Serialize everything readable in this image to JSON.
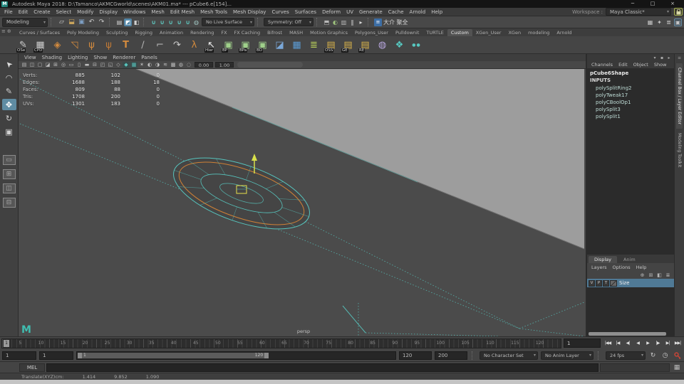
{
  "window": {
    "app_icon": "M",
    "title": "Autodesk Maya 2018: D:\\Tamanco\\AKMCGworld\\scenes\\AKM01.ma* --- pCube6.e[154]...",
    "minimize": "─",
    "maximize": "□",
    "close": "×"
  },
  "menubar": {
    "items": [
      "File",
      "Edit",
      "Create",
      "Select",
      "Modify",
      "Display",
      "Windows",
      "Mesh",
      "Edit Mesh",
      "Mesh Tools",
      "Mesh Display",
      "Curves",
      "Surfaces",
      "Deform",
      "UV",
      "Generate",
      "Cache",
      "Arnold",
      "Help"
    ],
    "workspace_label": "Workspace :",
    "workspace_value": "Maya Classic*"
  },
  "statusline": {
    "mode": "Modeling",
    "file_icons": [
      {
        "name": "new-scene-icon",
        "glyph": "▱",
        "style": "color:#cfcfcf"
      },
      {
        "name": "open-scene-icon",
        "glyph": "⬓",
        "style": "color:#c9a45c"
      },
      {
        "name": "save-scene-icon",
        "glyph": "▣",
        "style": "color:#7e9fc4"
      },
      {
        "name": "undo-icon",
        "glyph": "↶",
        "style": "color:#cccccc"
      },
      {
        "name": "redo-icon",
        "glyph": "↷",
        "style": "color:#cccccc"
      }
    ],
    "mask_icons": [
      {
        "name": "select-hierarchy-icon",
        "glyph": "▤",
        "style": "color:#d0d0d0"
      },
      {
        "name": "select-object-icon",
        "glyph": "◩",
        "style": "color:#ffffff",
        "active": true
      },
      {
        "name": "select-component-icon",
        "glyph": "◧",
        "style": "color:#d0d0d0"
      }
    ],
    "snap_icons": [
      {
        "name": "snap-grid-icon",
        "glyph": "∪",
        "style": "color:#5fc8c0;font-weight:bold"
      },
      {
        "name": "snap-curve-icon",
        "glyph": "∪",
        "style": "color:#5fc8c0;font-weight:bold"
      },
      {
        "name": "snap-point-icon",
        "glyph": "∪",
        "style": "color:#5fc8c0;font-weight:bold"
      },
      {
        "name": "snap-projected-center-icon",
        "glyph": "∪",
        "style": "color:#5fc8c0;font-weight:bold"
      },
      {
        "name": "snap-view-plane-icon",
        "glyph": "∪",
        "style": "color:#5fc8c0;font-weight:bold"
      },
      {
        "name": "make-live-icon",
        "glyph": "◍",
        "style": "color:#9fc4c0"
      }
    ],
    "live_surface": "No Live Surface",
    "symmetry": "Symmetry: Off",
    "render_icons": [
      {
        "name": "render-frame-icon",
        "glyph": "⬒",
        "style": "color:#b9b9b9"
      },
      {
        "name": "ipr-render-icon",
        "glyph": "◐",
        "style": "color:#9fc47e"
      },
      {
        "name": "render-settings-icon",
        "glyph": "▥",
        "style": "color:#b9b9b9"
      },
      {
        "name": "pause-icon",
        "glyph": "‖",
        "style": "color:#d9d9d9"
      },
      {
        "name": "play-next-icon",
        "glyph": "▸",
        "style": "color:#d9d9d9"
      }
    ],
    "ime_badge": "≡",
    "ime_text": "大介 聚全",
    "sidebar_icons": [
      {
        "name": "attribute-editor-toggle-icon",
        "glyph": "▦"
      },
      {
        "name": "tool-settings-toggle-icon",
        "glyph": "✦"
      },
      {
        "name": "channel-box-toggle-icon",
        "glyph": "≣"
      },
      {
        "name": "modeling-toolkit-toggle-icon",
        "glyph": "▣"
      }
    ]
  },
  "shelf": {
    "menu_icon": "≡",
    "gear_icon": "⊕",
    "tabs": [
      {
        "label": "Curves / Surfaces"
      },
      {
        "label": "Poly Modeling"
      },
      {
        "label": "Sculpting"
      },
      {
        "label": "Rigging"
      },
      {
        "label": "Animation"
      },
      {
        "label": "Rendering"
      },
      {
        "label": "FX"
      },
      {
        "label": "FX Caching"
      },
      {
        "label": "Bifrost"
      },
      {
        "label": "MASH"
      },
      {
        "label": "Motion Graphics"
      },
      {
        "label": "Polygons_User"
      },
      {
        "label": "Pulldownit"
      },
      {
        "label": "TURTLE"
      },
      {
        "label": "Custom",
        "active": true
      },
      {
        "label": "XGen_User"
      },
      {
        "label": "XGen"
      },
      {
        "label": "modeling"
      },
      {
        "label": "Arnold"
      }
    ],
    "icons": [
      {
        "name": "shelf-ose-icon",
        "glyph": "✎",
        "style": "color:#cfcfcf",
        "badge": "OSe"
      },
      {
        "name": "shelf-cpd-icon",
        "glyph": "▦",
        "style": "color:#cfcfcf",
        "badge": "CPD"
      },
      {
        "name": "shelf-shatter-icon",
        "glyph": "◈",
        "style": "color:#d28a3e",
        "badge": ""
      },
      {
        "name": "shelf-plane-arrow-icon",
        "glyph": "◹",
        "style": "color:#d28a3e",
        "badge": ""
      },
      {
        "name": "shelf-hand-a-icon",
        "glyph": "ψ",
        "style": "color:#d28a3e",
        "badge": ""
      },
      {
        "name": "shelf-hand-b-icon",
        "glyph": "ψ",
        "style": "color:#c07a36",
        "badge": ""
      },
      {
        "name": "shelf-type-tool-icon",
        "glyph": "T",
        "style": "color:#d28a3e;font-weight:bold",
        "badge": ""
      },
      {
        "name": "shelf-measure-icon",
        "glyph": "∕",
        "style": "color:#b4b4b4",
        "badge": ""
      },
      {
        "name": "shelf-measure-angle-icon",
        "glyph": "⌐",
        "style": "color:#b4b4b4",
        "badge": ""
      },
      {
        "name": "shelf-curve-arrow-icon",
        "glyph": "↷",
        "style": "color:#cccccc",
        "badge": ""
      },
      {
        "name": "shelf-joint-icon",
        "glyph": "λ",
        "style": "color:#d28a3e",
        "badge": ""
      },
      {
        "name": "shelf-hier-icon",
        "glyph": "↖",
        "style": "color:#eeeeee",
        "badge": "Hier"
      },
      {
        "name": "shelf-bp-icon",
        "glyph": "▣",
        "style": "color:#9fd08a",
        "badge": "BP"
      },
      {
        "name": "shelf-bpa-icon",
        "glyph": "▣",
        "style": "color:#9fd08a",
        "badge": "BPa"
      },
      {
        "name": "shelf-bo-icon",
        "glyph": "▣",
        "style": "color:#9fd08a",
        "badge": "BO"
      },
      {
        "name": "shelf-panel-icon",
        "glyph": "◪",
        "style": "color:#7aa7d8",
        "badge": ""
      },
      {
        "name": "shelf-grid-icon",
        "glyph": "▦",
        "style": "color:#5b9bd5",
        "badge": ""
      },
      {
        "name": "shelf-sliders-icon",
        "glyph": "≣",
        "style": "color:#b8cf5a",
        "badge": ""
      },
      {
        "name": "shelf-folder-oss-icon",
        "glyph": "▤",
        "style": "color:#d8b24a",
        "badge": "OSS"
      },
      {
        "name": "shelf-folder-ge-icon",
        "glyph": "▤",
        "style": "color:#d8b24a",
        "badge": "GE"
      },
      {
        "name": "shelf-folder-re-icon",
        "glyph": "▤",
        "style": "color:#d8b24a",
        "badge": "RE"
      },
      {
        "name": "shelf-wire-sphere-icon",
        "glyph": "◍",
        "style": "color:#b9a7e0",
        "badge": ""
      },
      {
        "name": "shelf-boolean-cube-icon",
        "glyph": "❖",
        "style": "color:#57c8c0",
        "badge": ""
      },
      {
        "name": "shelf-shader-spheres-icon",
        "glyph": "●●",
        "style": "color:#57c8c0;font-size:6px;letter-spacing:1px",
        "badge": ""
      }
    ]
  },
  "toolbox": {
    "tools": [
      {
        "name": "select-tool-icon",
        "glyph": "➤",
        "style": "color:#e0e0e0;display:inline-block;transform:rotate(-135deg)"
      },
      {
        "name": "lasso-tool-icon",
        "glyph": "◠",
        "style": "color:#d0d0d0"
      },
      {
        "name": "paint-select-tool-icon",
        "glyph": "✎",
        "style": "color:#d0d0d0"
      },
      {
        "name": "move-tool-icon",
        "glyph": "✥",
        "style": "color:#ffffff",
        "active": true
      },
      {
        "name": "rotate-tool-icon",
        "glyph": "↻",
        "style": "color:#d0d0d0"
      },
      {
        "name": "scale-tool-icon",
        "glyph": "▣",
        "style": "color:#d0d0d0"
      }
    ],
    "layouts": [
      {
        "name": "single-pane-layout-button",
        "glyph": "▭"
      },
      {
        "name": "four-pane-layout-button",
        "glyph": "⊞"
      },
      {
        "name": "two-pane-side-layout-button",
        "glyph": "◫"
      },
      {
        "name": "two-pane-stacked-layout-button",
        "glyph": "⊟"
      }
    ]
  },
  "viewport": {
    "menus": [
      "View",
      "Shading",
      "Lighting",
      "Show",
      "Renderer",
      "Panels"
    ],
    "toolbar_icons": [
      {
        "name": "view-layout-icon",
        "glyph": "▤"
      },
      {
        "name": "camera-attrs-icon",
        "glyph": "◫"
      },
      {
        "name": "bookmark-icon",
        "glyph": "▢"
      },
      {
        "name": "image-plane-icon",
        "glyph": "◪"
      },
      {
        "name": "pan-zoom-icon",
        "glyph": "⊞"
      },
      {
        "name": "oversampling-icon",
        "glyph": "◎"
      },
      {
        "name": "film-gate-icon",
        "glyph": "▭"
      },
      {
        "name": "resolution-gate-icon",
        "glyph": "▯"
      },
      {
        "name": "gate-mask-icon",
        "glyph": "▬"
      },
      {
        "name": "field-chart-icon",
        "glyph": "⊟"
      },
      {
        "name": "safe-action-icon",
        "glyph": "◰"
      },
      {
        "name": "safe-title-icon",
        "glyph": "◱"
      },
      {
        "name": "wireframe-mode-icon",
        "glyph": "◇"
      },
      {
        "name": "shaded-mode-icon",
        "glyph": "◆",
        "active": true
      },
      {
        "name": "textured-mode-icon",
        "glyph": "▦",
        "active": true
      },
      {
        "name": "lights-icon",
        "glyph": "✶"
      },
      {
        "name": "shadows-icon",
        "glyph": "◐"
      },
      {
        "name": "ao-icon",
        "glyph": "◑"
      },
      {
        "name": "motion-blur-icon",
        "glyph": "≋"
      },
      {
        "name": "multisample-icon",
        "glyph": "▩"
      },
      {
        "name": "xray-icon",
        "glyph": "◍"
      },
      {
        "name": "isolate-select-icon",
        "glyph": "◌"
      }
    ],
    "exposure": "0.00",
    "gamma": "1.00",
    "hud": [
      {
        "label": "Verts:",
        "v1": "885",
        "v2": "102",
        "v3": "0"
      },
      {
        "label": "Edges:",
        "v1": "1688",
        "v2": "188",
        "v3": "18"
      },
      {
        "label": "Faces:",
        "v1": "809",
        "v2": "88",
        "v3": "0"
      },
      {
        "label": "Tris:",
        "v1": "1708",
        "v2": "200",
        "v3": "0"
      },
      {
        "label": "UVs:",
        "v1": "1301",
        "v2": "183",
        "v3": "0"
      }
    ],
    "camera_label": "persp",
    "logo": "M",
    "wireframe_color": "#57c4bd",
    "selected_edge_color": "#cf8136",
    "manipulator_color": "#d8e04a"
  },
  "channel_box": {
    "menus": [
      "Channels",
      "Edit",
      "Object",
      "Show"
    ],
    "header_icons": [
      {
        "name": "cb-manip-icon",
        "glyph": "▾"
      },
      {
        "name": "cb-speed-icon",
        "glyph": "▪"
      },
      {
        "name": "cb-options-icon",
        "glyph": "▸"
      }
    ],
    "node_name": "pCube6Shape",
    "section": "INPUTS",
    "inputs": [
      "polySplitRing2",
      "polyTweak17",
      "polyCBoolOp1",
      "polySplit3",
      "polySplit1"
    ]
  },
  "layer_editor": {
    "tabs": [
      {
        "label": "Display",
        "active": true
      },
      {
        "label": "Anim"
      }
    ],
    "menus": [
      "Layers",
      "Options",
      "Help"
    ],
    "toolbar_icons": [
      {
        "name": "layer-options-icon",
        "glyph": "⊕"
      },
      {
        "name": "layer-new-icon",
        "glyph": "⊞"
      },
      {
        "name": "layer-new-selected-icon",
        "glyph": "◧"
      },
      {
        "name": "layer-list-icon",
        "glyph": "≣"
      }
    ],
    "layer": {
      "visible": "V",
      "playback": "P",
      "template": "T",
      "name": "Size"
    }
  },
  "side_tabs": [
    {
      "label": "Channel Box / Layer Editor",
      "active": true
    },
    {
      "label": "Modeling Toolkit"
    }
  ],
  "timeline": {
    "current_frame": "1",
    "tick_labels": [
      "5",
      "10",
      "15",
      "20",
      "25",
      "30",
      "35",
      "40",
      "45",
      "50",
      "55",
      "60",
      "65",
      "70",
      "75",
      "80",
      "85",
      "90",
      "95",
      "100",
      "105",
      "110",
      "115",
      "120"
    ],
    "transport": [
      {
        "name": "go-to-start-button",
        "glyph": "|◀◀"
      },
      {
        "name": "step-back-frame-button",
        "glyph": "|◀"
      },
      {
        "name": "step-back-key-button",
        "glyph": "◀|"
      },
      {
        "name": "play-backwards-button",
        "glyph": "◀"
      },
      {
        "name": "play-forwards-button",
        "glyph": "▶"
      },
      {
        "name": "step-forward-key-button",
        "glyph": "|▶"
      },
      {
        "name": "step-forward-frame-button",
        "glyph": "▶|"
      },
      {
        "name": "go-to-end-button",
        "glyph": "▶▶|"
      }
    ]
  },
  "range_slider": {
    "anim_start": "1",
    "playback_start": "1",
    "bar_start": "1",
    "bar_end": "120",
    "playback_end": "120",
    "anim_end": "200",
    "character_set": "No Character Set",
    "anim_layer": "No Anim Layer",
    "fps": "24 fps",
    "loop_icon": "↻",
    "clock_icon": "◷"
  },
  "command_line": {
    "label": "MEL",
    "script_editor_icon": "▦"
  },
  "help_line": {
    "label": "Translate(XYZ)cm:",
    "values": [
      "1.414",
      "9.852",
      "1.090"
    ]
  }
}
